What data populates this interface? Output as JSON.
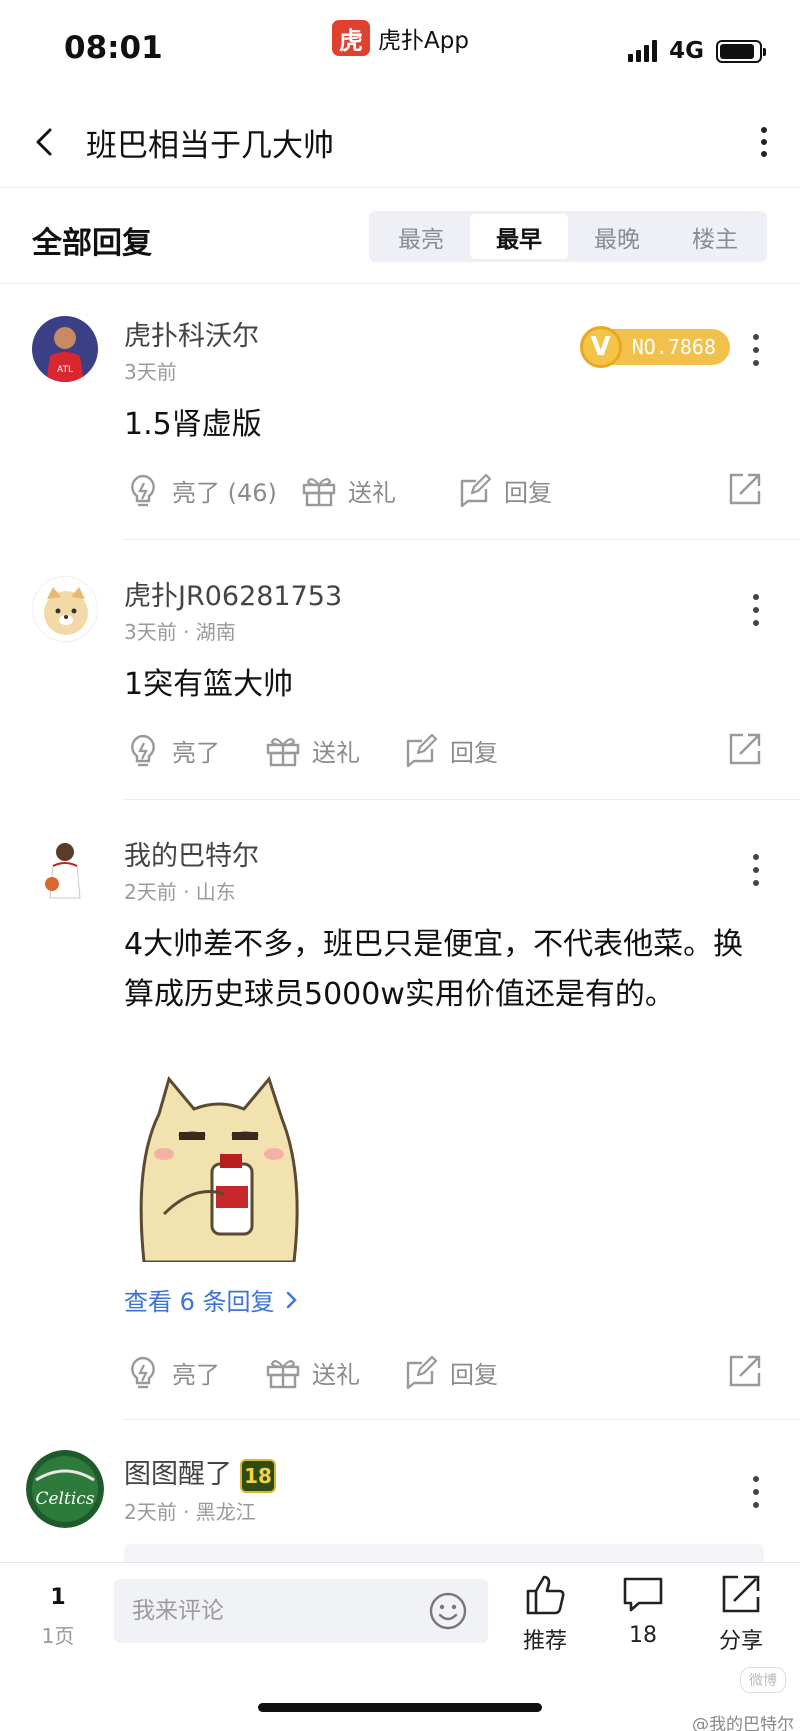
{
  "status_bar": {
    "time": "08:01",
    "app_logo_glyph": "虎",
    "app_name": "虎扑App",
    "network": "4G",
    "battery_level_percent": 90
  },
  "nav": {
    "title": "班巴相当于几大帅",
    "back_icon": "chevron-left-icon",
    "more_icon": "vertical-dots-icon"
  },
  "filter": {
    "title": "全部回复",
    "tabs": [
      "最亮",
      "最早",
      "最晚",
      "楼主"
    ],
    "active_tab": "最早"
  },
  "comments": [
    {
      "user": "虎扑科沃尔",
      "meta": "3天前",
      "badge_no": "NO.7868",
      "text": "1.5肾虚版",
      "light_label": "亮了 (46)",
      "gift_label": "送礼",
      "reply_label": "回复"
    },
    {
      "user": "虎扑JR06281753",
      "meta": "3天前 · 湖南",
      "text": "1突有篮大帅",
      "light_label": "亮了",
      "gift_label": "送礼",
      "reply_label": "回复"
    },
    {
      "user": "我的巴特尔",
      "meta": "2天前 · 山东",
      "text": "4大帅差不多，班巴只是便宜，不代表他菜。换算成历史球员5000w实用价值还是有的。",
      "view_replies": "查看 6 条回复",
      "light_label": "亮了",
      "gift_label": "送礼",
      "reply_label": "回复"
    },
    {
      "user": "图图醒了",
      "level": "18",
      "avatar_text": "Celtics",
      "meta": "2天前 · 黑龙江"
    }
  ],
  "bottom_bar": {
    "page_number": "1",
    "page_unit": "1页",
    "comment_placeholder": "我来评论",
    "recommend_label": "推荐",
    "comment_count": "18",
    "share_label": "分享",
    "watermark": "@我的巴特尔",
    "watermark_logo": "微博"
  },
  "colors": {
    "accent_blue": "#3b74d6",
    "vip_gold": "#f2c14b",
    "app_red": "#e2402f"
  }
}
